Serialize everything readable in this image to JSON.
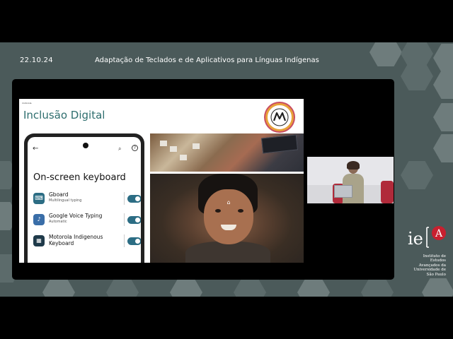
{
  "header": {
    "date": "22.10.24",
    "title": "Adaptação de Teclados e de Aplicativos para Línguas Indígenas"
  },
  "slide": {
    "label": "motorola",
    "title": "Inclusão Digital"
  },
  "phone": {
    "heading": "On-screen keyboard",
    "keyboards": [
      {
        "name": "Gboard",
        "subtitle": "Multilingual typing",
        "enabled": true,
        "icon": "gboard-icon"
      },
      {
        "name": "Google Voice Typing",
        "subtitle": "Automatic",
        "enabled": true,
        "icon": "microphone-icon"
      },
      {
        "name": "Motorola Indigenous Keyboard",
        "subtitle": "",
        "enabled": true,
        "icon": "keyboard-icon"
      }
    ]
  },
  "brand": {
    "logo_letters": "ie",
    "logo_badge": "A",
    "lines": [
      "Instituto de",
      "Estudos",
      "Avançados da",
      "Universidade de",
      "São Paulo"
    ]
  },
  "colors": {
    "stage_bg": "#4b5a5a",
    "slide_title": "#2e6e6e",
    "toggle_on": "#2c6d84",
    "brand_red": "#c8202f"
  }
}
